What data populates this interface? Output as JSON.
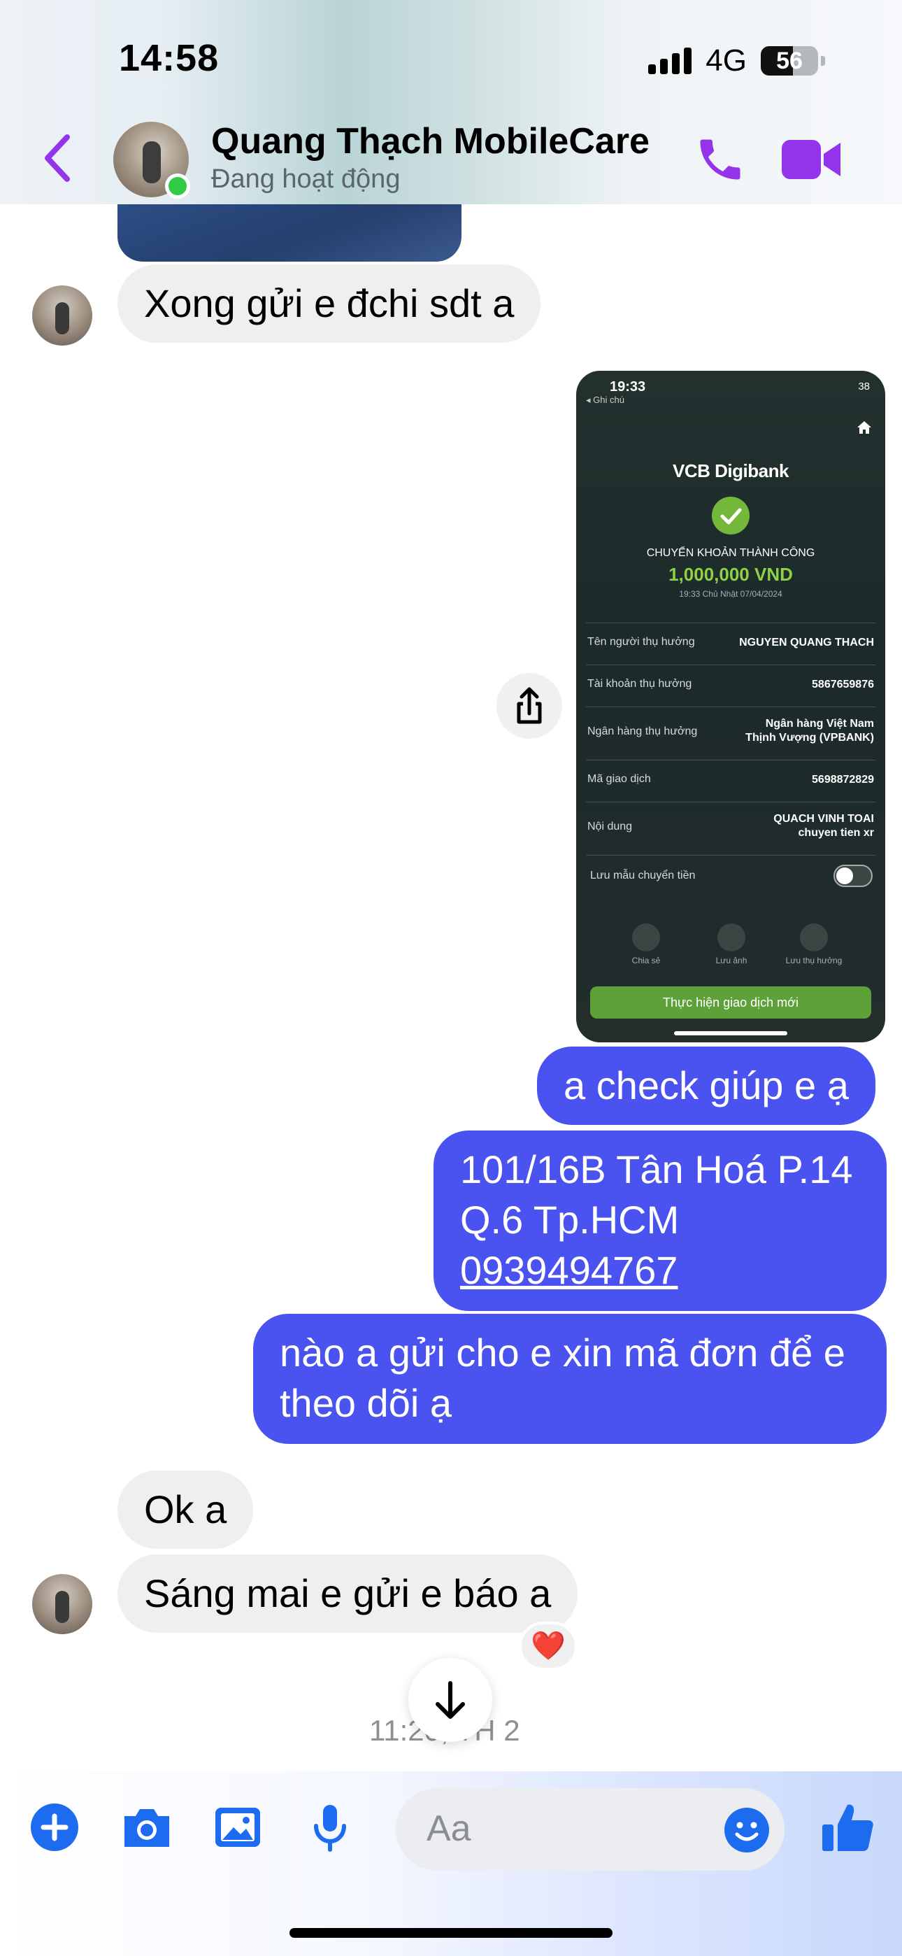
{
  "status_bar": {
    "time": "14:58",
    "network": "4G",
    "battery": "56"
  },
  "header": {
    "name": "Quang Thạch MobileCare",
    "status": "Đang hoạt động"
  },
  "messages": {
    "m1": "Xong gửi e đchi sdt a",
    "m2": "a check giúp e ạ",
    "m3_line1": "101/16B Tân Hoá P.14",
    "m3_line2": "Q.6 Tp.HCM",
    "m3_phone": "0939494767",
    "m4": "nào a gửi cho e xin mã đơn để e theo dõi ạ",
    "m5": "Ok a",
    "m6": "Sáng mai e gửi e báo a",
    "reaction": "❤️",
    "timestamp": "11:20, TH 2"
  },
  "receipt": {
    "time": "19:33",
    "back_label": "◂ Ghi chú",
    "battery": "38",
    "logo": "VCB Digibank",
    "success": "CHUYỂN KHOẢN THÀNH CÔNG",
    "amount": "1,000,000 VND",
    "date": "19:33 Chủ Nhật 07/04/2024",
    "rows": [
      {
        "label": "Tên người thụ hưởng",
        "value": "NGUYEN QUANG THACH"
      },
      {
        "label": "Tài khoản thụ hưởng",
        "value": "5867659876"
      },
      {
        "label": "Ngân hàng thụ hưởng",
        "value": "Ngân hàng  Việt Nam Thịnh Vượng (VPBANK)"
      },
      {
        "label": "Mã giao dịch",
        "value": "5698872829"
      },
      {
        "label": "Nội dung",
        "value": "QUACH VINH TOAI chuyen tien xr"
      },
      {
        "label": "Lưu mẫu chuyển tiền",
        "value": ""
      }
    ],
    "actions": [
      "Chia sẻ",
      "Lưu ảnh",
      "Lưu thụ hưởng"
    ],
    "button": "Thực hiện giao dịch mới"
  },
  "composer": {
    "placeholder": "Aa"
  },
  "icons": {
    "back": "chevron-left-icon",
    "call": "phone-icon",
    "video": "video-camera-icon",
    "share": "share-icon",
    "scroll": "arrow-down-icon",
    "plus": "plus-circle-icon",
    "camera": "camera-icon",
    "gallery": "image-icon",
    "mic": "microphone-icon",
    "emoji": "smiley-icon",
    "like": "thumbs-up-icon"
  },
  "colors": {
    "accent": "#9333ea",
    "outgoing_bubble": "#4a52f0",
    "incoming_bubble": "#efeff0",
    "composer_icons": "#1d6cf0",
    "online": "#31cc46"
  }
}
